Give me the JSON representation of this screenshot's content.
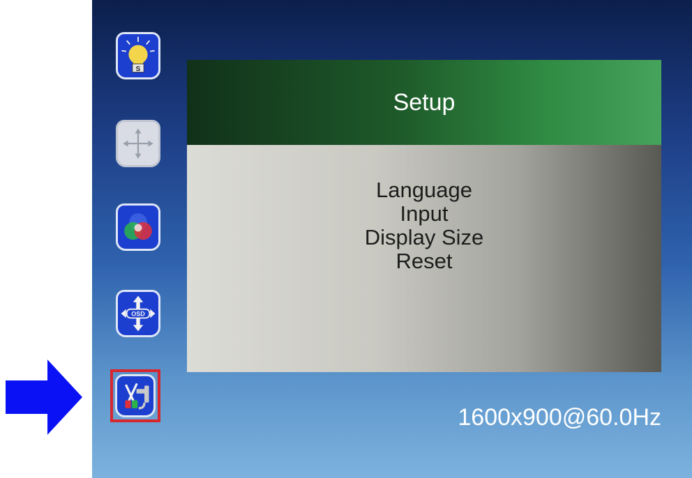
{
  "menu": {
    "title": "Setup",
    "items": [
      "Language",
      "Input",
      "Display Size",
      "Reset"
    ]
  },
  "status": {
    "resolution": "1600x900@60.0Hz"
  },
  "sidebar": {
    "icons": [
      "brightness-icon",
      "position-icon",
      "color-icon",
      "osd-settings-icon",
      "setup-tools-icon"
    ],
    "selected": "setup-tools-icon"
  },
  "icon_labels": {
    "brightness_glyph": "S",
    "osd_glyph": "OSD"
  },
  "colors": {
    "header_green": "#2f8a42",
    "selection_border": "#d7262e",
    "pointer_arrow": "#0a12f5",
    "icon_tile": "#1c3fd0"
  }
}
